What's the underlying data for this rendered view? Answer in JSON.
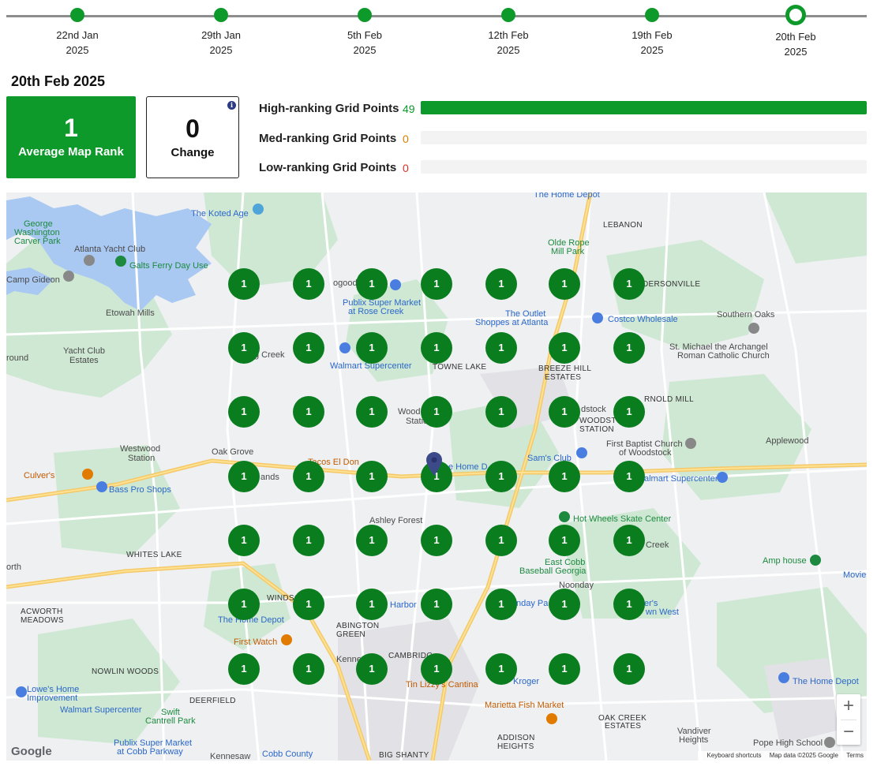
{
  "timeline": [
    {
      "date": "22nd Jan",
      "year": "2025"
    },
    {
      "date": "29th Jan",
      "year": "2025"
    },
    {
      "date": "5th Feb",
      "year": "2025"
    },
    {
      "date": "12th Feb",
      "year": "2025"
    },
    {
      "date": "19th Feb",
      "year": "2025"
    },
    {
      "date": "20th Feb",
      "year": "2025",
      "active": true
    }
  ],
  "selected_date": "20th Feb 2025",
  "avg_rank": {
    "value": "1",
    "label": "Average Map Rank"
  },
  "change": {
    "value": "0",
    "label": "Change",
    "info_icon": "info-icon"
  },
  "rankings": [
    {
      "label": "High-ranking Grid Points",
      "value": "49",
      "fraction": 1.0,
      "color": "#0e9a2b"
    },
    {
      "label": "Med-ranking Grid Points",
      "value": "0",
      "fraction": 0,
      "color": "#e07b00"
    },
    {
      "label": "Low-ranking Grid Points",
      "value": "0",
      "fraction": 0,
      "color": "#d93025"
    }
  ],
  "grid_rank": "1",
  "map_labels": [
    {
      "t": "The Koted Age",
      "c": "poi"
    },
    {
      "t": "George",
      "c": "poi-green"
    },
    {
      "t": "Washington",
      "c": "poi-green"
    },
    {
      "t": "Carver Park",
      "c": "poi-green"
    },
    {
      "t": "Atlanta Yacht Club",
      "c": ""
    },
    {
      "t": "Galts Ferry Day Use",
      "c": "poi-green"
    },
    {
      "t": "Camp Gideon",
      "c": ""
    },
    {
      "t": "Etowah Mills",
      "c": ""
    },
    {
      "t": "Yacht Club",
      "c": ""
    },
    {
      "t": "Estates",
      "c": ""
    },
    {
      "t": "round",
      "c": ""
    },
    {
      "t": "Westwood",
      "c": ""
    },
    {
      "t": "Station",
      "c": ""
    },
    {
      "t": "Culver's",
      "c": "poi-orange"
    },
    {
      "t": "Bass Pro Shops",
      "c": "poi"
    },
    {
      "t": "WHITES LAKE",
      "c": "dark"
    },
    {
      "t": "orth",
      "c": ""
    },
    {
      "t": "ACWORTH",
      "c": "dark"
    },
    {
      "t": "MEADOWS",
      "c": "dark"
    },
    {
      "t": "The Home Depot",
      "c": "poi"
    },
    {
      "t": "First Watch",
      "c": "poi-orange"
    },
    {
      "t": "NOWLIN WOODS",
      "c": "dark"
    },
    {
      "t": "Lowe's Home",
      "c": "poi"
    },
    {
      "t": "Improvement",
      "c": "poi"
    },
    {
      "t": "DEERFIELD",
      "c": "dark"
    },
    {
      "t": "Walmart Supercenter",
      "c": "poi"
    },
    {
      "t": "Swift",
      "c": "poi-green"
    },
    {
      "t": "Cantrell Park",
      "c": "poi-green"
    },
    {
      "t": "Publix Super Market",
      "c": "poi"
    },
    {
      "t": "at Cobb Parkway",
      "c": "poi"
    },
    {
      "t": "Kennesaw",
      "c": ""
    },
    {
      "t": "Cobb County",
      "c": "poi"
    },
    {
      "t": "BIG SHANTY",
      "c": "dark"
    },
    {
      "t": "Oak Grove",
      "c": ""
    },
    {
      "t": "Tacos El Don",
      "c": "poi-orange"
    },
    {
      "t": "Ashley Forest",
      "c": ""
    },
    {
      "t": "WINDSOR",
      "c": "dark"
    },
    {
      "t": "ABINGTON",
      "c": "dark"
    },
    {
      "t": "GREEN",
      "c": "dark"
    },
    {
      "t": "Kennesaw",
      "c": ""
    },
    {
      "t": "CAMBRIDG",
      "c": "dark"
    },
    {
      "t": "Tin Lizzy's Cantina",
      "c": "poi-orange"
    },
    {
      "t": "Marietta Fish Market",
      "c": "poi-orange"
    },
    {
      "t": "ADDISON",
      "c": "dark"
    },
    {
      "t": "HEIGHTS",
      "c": "dark"
    },
    {
      "t": "Publix Super Market",
      "c": "poi"
    },
    {
      "t": "at Rose Creek",
      "c": "poi"
    },
    {
      "t": "Walmart Supercenter",
      "c": "poi"
    },
    {
      "t": "TOWNE LAKE",
      "c": "dark"
    },
    {
      "t": "The Outlet",
      "c": "poi"
    },
    {
      "t": "Shoppes at Atlanta",
      "c": "poi"
    },
    {
      "t": "Olde Rope",
      "c": "poi-green"
    },
    {
      "t": "Mill Park",
      "c": "poi-green"
    },
    {
      "t": "The Home Depot",
      "c": "poi"
    },
    {
      "t": "LEBANON",
      "c": "dark"
    },
    {
      "t": "DERSONVILLE",
      "c": "dark"
    },
    {
      "t": "Costco Wholesale",
      "c": "poi"
    },
    {
      "t": "Southern Oaks",
      "c": ""
    },
    {
      "t": "BREEZE HILL",
      "c": "dark"
    },
    {
      "t": "ESTATES",
      "c": "dark"
    },
    {
      "t": "St. Michael the Archangel",
      "c": ""
    },
    {
      "t": "Roman Catholic Church",
      "c": ""
    },
    {
      "t": "RNOLD MILL",
      "c": "dark"
    },
    {
      "t": "WOODSTOCK",
      "c": "dark"
    },
    {
      "t": "STATION",
      "c": "dark"
    },
    {
      "t": "Applewood",
      "c": ""
    },
    {
      "t": "First Baptist Church",
      "c": ""
    },
    {
      "t": "of Woodstock",
      "c": ""
    },
    {
      "t": "Sam's Club",
      "c": "poi"
    },
    {
      "t": "almart Supercenter",
      "c": "poi"
    },
    {
      "t": "Hot Wheels Skate Center",
      "c": "poi-green"
    },
    {
      "t": "East Cobb",
      "c": "poi-green"
    },
    {
      "t": "Baseball Georgia",
      "c": "poi-green"
    },
    {
      "t": "Creek",
      "c": ""
    },
    {
      "t": "Amp house",
      "c": "poi-green"
    },
    {
      "t": "Movie",
      "c": "poi"
    },
    {
      "t": "Noonday",
      "c": ""
    },
    {
      "t": "Harbor",
      "c": "poi"
    },
    {
      "t": "Kroger",
      "c": "poi"
    },
    {
      "t": "OAK CREEK",
      "c": "dark"
    },
    {
      "t": "ESTATES",
      "c": "dark"
    },
    {
      "t": "Vandiver",
      "c": ""
    },
    {
      "t": "Heights",
      "c": ""
    },
    {
      "t": "The Home Depot",
      "c": "poi"
    },
    {
      "t": "Pope High School",
      "c": ""
    },
    {
      "t": "ogood",
      "c": ""
    },
    {
      "t": "g Creek",
      "c": ""
    },
    {
      "t": "Wood",
      "c": ""
    },
    {
      "t": "Statio",
      "c": ""
    },
    {
      "t": "ands",
      "c": ""
    },
    {
      "t": "e Home D",
      "c": "poi"
    },
    {
      "t": "dstock",
      "c": ""
    },
    {
      "t": "nday Pa",
      "c": "poi"
    },
    {
      "t": "er's",
      "c": "poi"
    },
    {
      "t": "wn West",
      "c": "poi"
    }
  ],
  "zoom": {
    "plus": "+",
    "minus": "−"
  },
  "google_logo": "Google",
  "attribution": {
    "shortcuts": "Keyboard shortcuts",
    "data": "Map data ©2025 Google",
    "terms": "Terms"
  }
}
